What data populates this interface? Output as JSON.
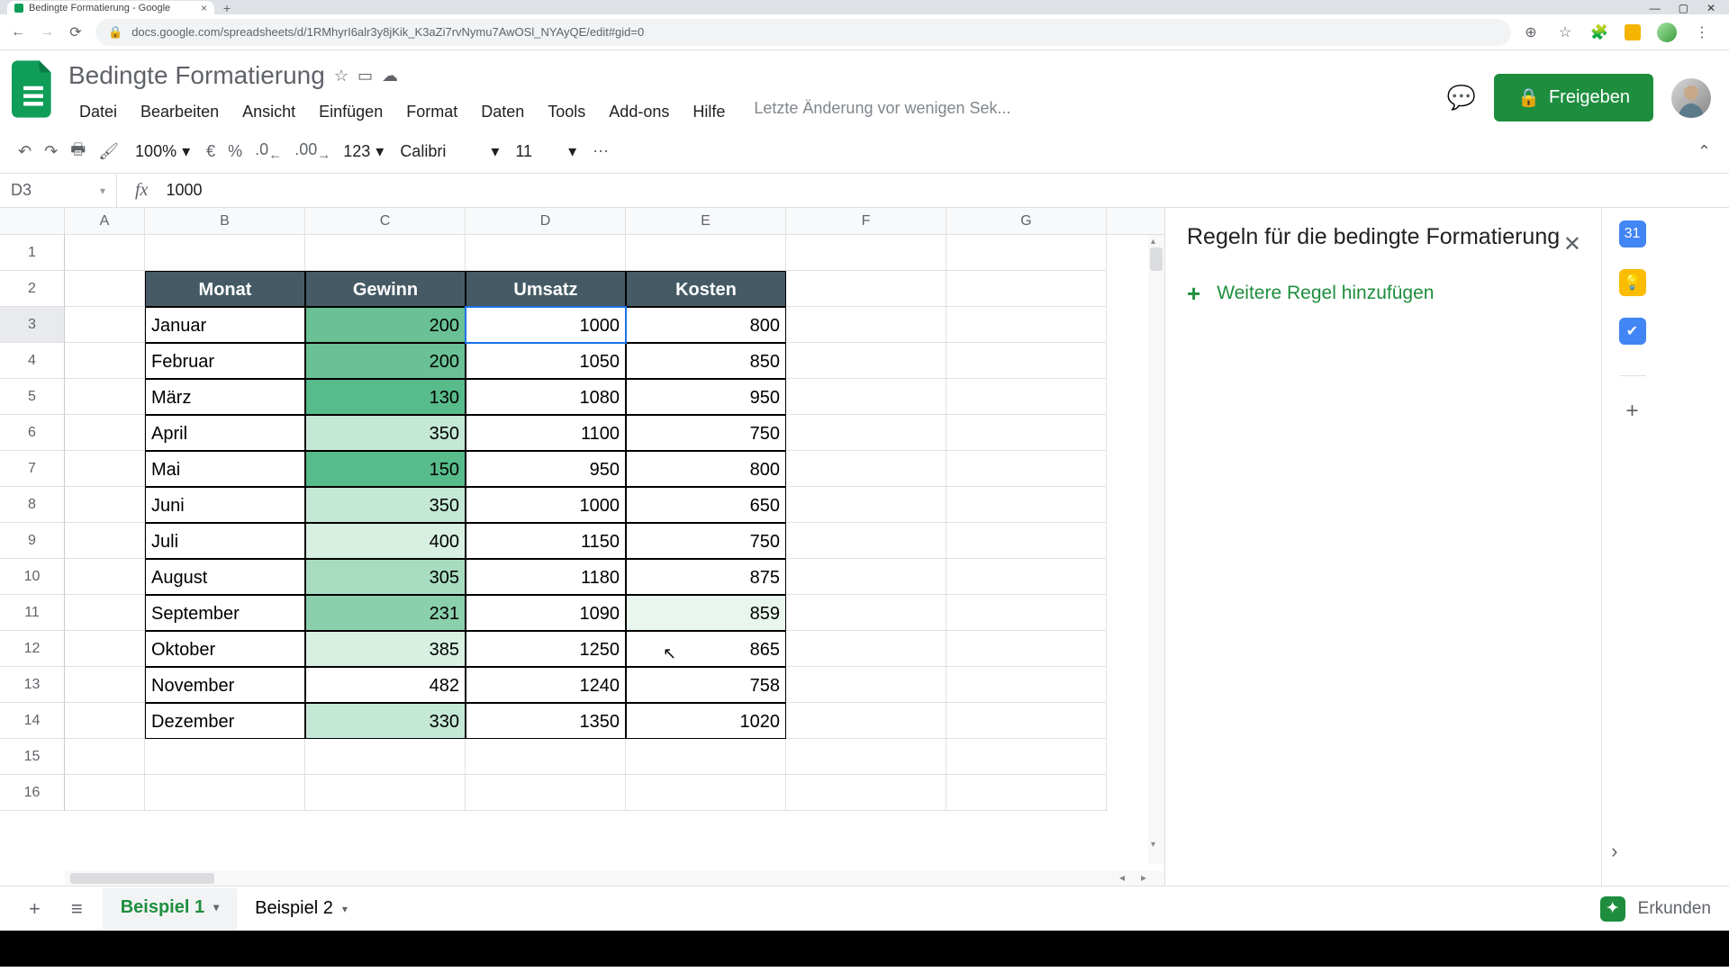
{
  "browser": {
    "tab_title": "Bedingte Formatierung - Google",
    "url": "docs.google.com/spreadsheets/d/1RMhyrI6alr3y8jKik_K3aZi7rvNymu7AwOSl_NYAyQE/edit#gid=0"
  },
  "doc": {
    "title": "Bedingte Formatierung",
    "menus": [
      "Datei",
      "Bearbeiten",
      "Ansicht",
      "Einfügen",
      "Format",
      "Daten",
      "Tools",
      "Add-ons",
      "Hilfe"
    ],
    "last_edit": "Letzte Änderung vor wenigen Sek...",
    "share_label": "Freigeben"
  },
  "toolbar": {
    "zoom": "100%",
    "currency": "€",
    "percent": "%",
    "dec_dec": ".0",
    "inc_dec": ".00",
    "num_fmt": "123",
    "font": "Calibri",
    "font_size": "11"
  },
  "formula": {
    "cell_ref": "D3",
    "value": "1000"
  },
  "columns": [
    "A",
    "B",
    "C",
    "D",
    "E",
    "F",
    "G"
  ],
  "sheet": {
    "headers": {
      "B": "Monat",
      "C": "Gewinn",
      "D": "Umsatz",
      "E": "Kosten"
    },
    "rows": [
      {
        "r": 3,
        "B": "Januar",
        "C": "200",
        "D": "1000",
        "E": "800",
        "cfC": "f1",
        "cfE": ""
      },
      {
        "r": 4,
        "B": "Februar",
        "C": "200",
        "D": "1050",
        "E": "850",
        "cfC": "f1",
        "cfE": ""
      },
      {
        "r": 5,
        "B": "März",
        "C": "130",
        "D": "1080",
        "E": "950",
        "cfC": "f0",
        "cfE": ""
      },
      {
        "r": 6,
        "B": "April",
        "C": "350",
        "D": "1100",
        "E": "750",
        "cfC": "f4",
        "cfE": ""
      },
      {
        "r": 7,
        "B": "Mai",
        "C": "150",
        "D": "950",
        "E": "800",
        "cfC": "f0",
        "cfE": ""
      },
      {
        "r": 8,
        "B": "Juni",
        "C": "350",
        "D": "1000",
        "E": "650",
        "cfC": "f4",
        "cfE": ""
      },
      {
        "r": 9,
        "B": "Juli",
        "C": "400",
        "D": "1150",
        "E": "750",
        "cfC": "f5",
        "cfE": ""
      },
      {
        "r": 10,
        "B": "August",
        "C": "305",
        "D": "1180",
        "E": "875",
        "cfC": "f3",
        "cfE": ""
      },
      {
        "r": 11,
        "B": "September",
        "C": "231",
        "D": "1090",
        "E": "859",
        "cfC": "f2",
        "cfE": "f6"
      },
      {
        "r": 12,
        "B": "Oktober",
        "C": "385",
        "D": "1250",
        "E": "865",
        "cfC": "f5",
        "cfE": ""
      },
      {
        "r": 13,
        "B": "November",
        "C": "482",
        "D": "1240",
        "E": "758",
        "cfC": "f7",
        "cfE": ""
      },
      {
        "r": 14,
        "B": "Dezember",
        "C": "330",
        "D": "1350",
        "E": "1020",
        "cfC": "f4",
        "cfE": ""
      }
    ],
    "active_cell": {
      "row": 3,
      "col": "D"
    }
  },
  "panel": {
    "title": "Regeln für die bedingte Formatierung",
    "add_rule": "Weitere Regel hinzufügen"
  },
  "tabs": {
    "sheets": [
      {
        "name": "Beispiel 1",
        "active": true
      },
      {
        "name": "Beispiel 2",
        "active": false
      }
    ],
    "explore": "Erkunden"
  }
}
